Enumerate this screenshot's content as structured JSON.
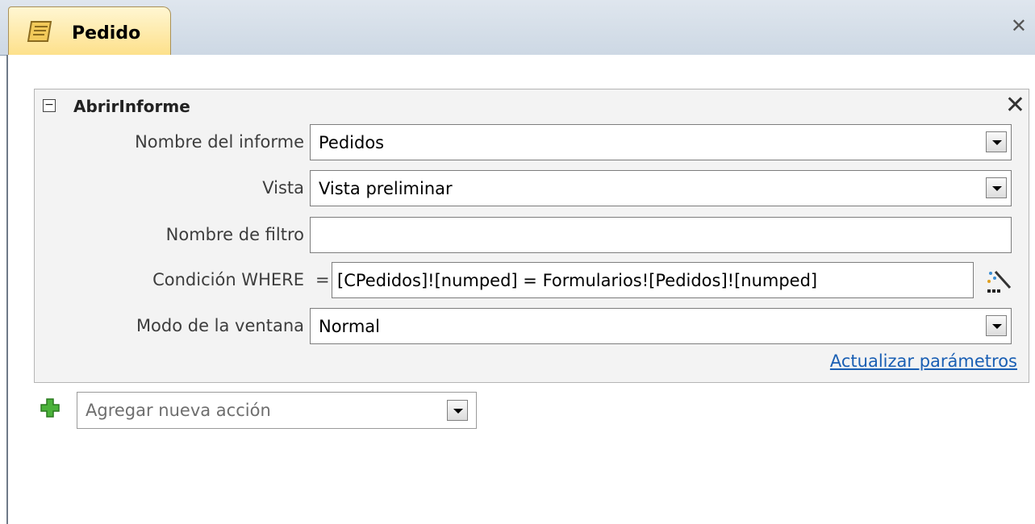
{
  "tab": {
    "title": "Pedido",
    "icon": "macro-icon"
  },
  "window": {
    "close_icon": "close-icon"
  },
  "action": {
    "name": "AbrirInforme",
    "rows": [
      {
        "label": "Nombre del informe",
        "value": "Pedidos"
      },
      {
        "label": "Vista",
        "value": "Vista preliminar"
      },
      {
        "label": "Nombre de filtro",
        "value": ""
      },
      {
        "label": "Condición WHERE",
        "prefix": "=",
        "value": "[CPedidos]![numped] = Formularios![Pedidos]![numped]"
      },
      {
        "label": "Modo de la ventana",
        "value": "Normal"
      }
    ],
    "update_link": "Actualizar parámetros"
  },
  "add_action": {
    "placeholder": "Agregar nueva acción"
  }
}
